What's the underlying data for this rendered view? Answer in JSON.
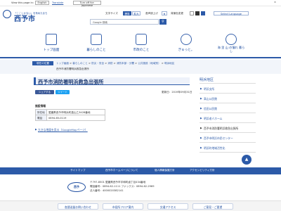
{
  "topbar": {
    "translate_label": "View this page in:",
    "google_label": "English",
    "translate_link": "Translate",
    "turn_off": "Turn off for: Japanese",
    "close": "×"
  },
  "header": {
    "tagline": "「ここしかない」を有めたまち",
    "site_name": "西予市",
    "size_label": "文字サイズ",
    "size_standard": "標準",
    "size_large": "拡大",
    "reader_label": "音声読上げ",
    "reader_icon_text": "★",
    "color_label": "背景色変更",
    "search_placeholder": "Google 検索",
    "select_language": "Select Language"
  },
  "nav": [
    {
      "label": "トップ画面",
      "icon": "home-icon"
    },
    {
      "label": "暮らしのこと",
      "icon": "life-icon"
    },
    {
      "label": "市政のこと",
      "icon": "cityhall-icon"
    },
    {
      "label": "ぎゅっと。",
      "icon": "heart-icon"
    },
    {
      "label": "海 里 山 の憧れ 暮らし",
      "icon": "nature-icon"
    }
  ],
  "breadcrumb": {
    "label": "現在の位置",
    "items": [
      "トップ画面",
      "暮らしのこと",
      "防災・安全",
      "消防",
      "消防本部・分署",
      "公共施設（地域別）",
      "明浜地区"
    ],
    "current": "西予市消防署明浜救急出張所"
  },
  "main": {
    "title": "西予市消防署明浜救急出張所",
    "share_label": "シェアする",
    "tweet_label": "ツイート",
    "updated": "更新日：2019年09月31日",
    "section_head": "施設情報",
    "info": [
      {
        "key": "所在地",
        "value": "愛媛県西予市明浜町高山乙3428番地"
      },
      {
        "key": "電話",
        "value": "0894-65-0119"
      }
    ],
    "map_link": "大きな地図を見る（GoogleMapページ）"
  },
  "sidebar": {
    "heading": "明浜地区",
    "items": [
      "明浜支所",
      "高山公民館",
      "信田公民館",
      "明浜老人ホーム",
      "西予市消防署明浜救急出張所",
      "西予市明浜市民センター",
      "明浜町地域活性化"
    ]
  },
  "footer_nav": [
    "サイトマップ",
    "西予市ホームページについて",
    "個人情報保護方針",
    "アクセシビリティ方針"
  ],
  "footer": {
    "logo_text": "西予",
    "address": "〒797-8501 愛媛県西予市宇和町卤丁目434番地",
    "phone": "電話番号：0894-62-1111 ファックス：0894-62-2969",
    "corp_no": "法人番号：4000020382141"
  },
  "bottom_buttons": [
    "各請送量お問い合わせ",
    "市役所フロア案内",
    "交通アクセス",
    "ご意見・ご要望"
  ],
  "page_top": "▲",
  "colors": {
    "brand": "#2c5aa8",
    "brand_dark": "#1f4ea0"
  }
}
